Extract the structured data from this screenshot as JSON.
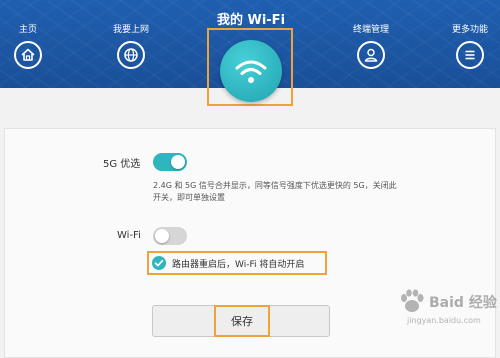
{
  "nav": {
    "home": {
      "label": "主页",
      "icon": "home-icon"
    },
    "internet": {
      "label": "我要上网",
      "icon": "globe-icon"
    },
    "wifi": {
      "label": "我的 Wi-Fi",
      "icon": "wifi-icon"
    },
    "terminal": {
      "label": "终端管理",
      "icon": "user-icon"
    },
    "more": {
      "label": "更多功能",
      "icon": "menu-icon"
    }
  },
  "settings": {
    "prefer5g": {
      "label": "5G 优选",
      "enabled": true,
      "description": "2.4G 和 5G 信号合并显示，同等信号强度下优选更快的 5G，关闭此开关，即可单独设置"
    },
    "wifi": {
      "label": "Wi-Fi",
      "enabled": false,
      "restart_note": "路由器重启后，Wi-Fi 将自动开启",
      "restart_checked": true
    }
  },
  "actions": {
    "save_label": "保存"
  },
  "watermark": {
    "text": "Baid 经验",
    "url": "jingyan.baidu.com"
  },
  "colors": {
    "header": "#1f5fb0",
    "accent": "#2fb5c0",
    "highlight": "#f0a23a",
    "toggle_off": "#d6d6d6"
  }
}
